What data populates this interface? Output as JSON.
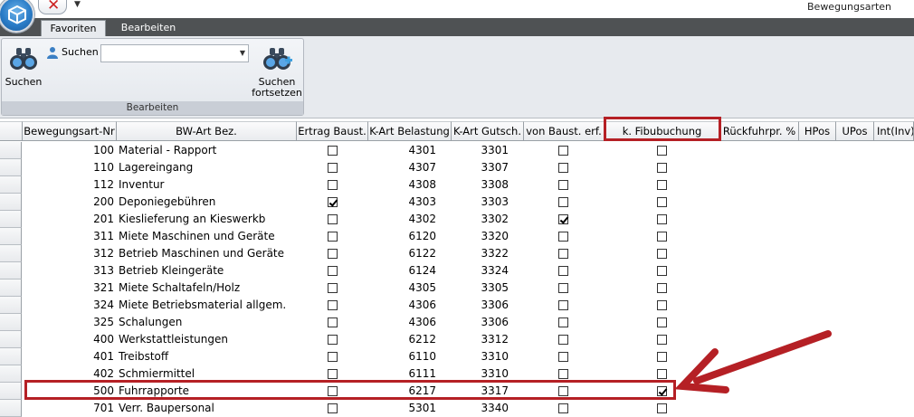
{
  "window": {
    "title": "Bewegungsarten"
  },
  "ribbon": {
    "tabs": [
      "Favoriten",
      "Bearbeiten"
    ],
    "group_label": "Bearbeiten",
    "search_label": "Suchen",
    "search_value": "",
    "btn_suchen": "Suchen",
    "btn_fortsetzen_1": "Suchen",
    "btn_fortsetzen_2": "fortsetzen"
  },
  "grid": {
    "columns": [
      "Bewegungsart-Nr",
      "BW-Art Bez.",
      "Ertrag Baust.",
      "K-Art Belastung",
      "K-Art Gutsch.",
      "von Baust. erf.",
      "k. Fibubuchung",
      "Rückfuhrpr. %",
      "HPos",
      "UPos",
      "Int(Inv)"
    ],
    "rows": [
      {
        "nr": "100",
        "bez": "Material - Rapport",
        "ertrag": false,
        "belast": "4301",
        "gutsch": "3301",
        "vonbaust": false,
        "fibu": false
      },
      {
        "nr": "110",
        "bez": "Lagereingang",
        "ertrag": false,
        "belast": "4307",
        "gutsch": "3307",
        "vonbaust": false,
        "fibu": false
      },
      {
        "nr": "112",
        "bez": "Inventur",
        "ertrag": false,
        "belast": "4308",
        "gutsch": "3308",
        "vonbaust": false,
        "fibu": false
      },
      {
        "nr": "200",
        "bez": "Deponiegebühren",
        "ertrag": true,
        "belast": "4303",
        "gutsch": "3303",
        "vonbaust": false,
        "fibu": false
      },
      {
        "nr": "201",
        "bez": "Kieslieferung an Kieswerkb",
        "ertrag": false,
        "belast": "4302",
        "gutsch": "3302",
        "vonbaust": true,
        "fibu": false
      },
      {
        "nr": "311",
        "bez": "Miete Maschinen und Geräte",
        "ertrag": false,
        "belast": "6120",
        "gutsch": "3320",
        "vonbaust": false,
        "fibu": false
      },
      {
        "nr": "312",
        "bez": "Betrieb Maschinen und Geräte",
        "ertrag": false,
        "belast": "6122",
        "gutsch": "3322",
        "vonbaust": false,
        "fibu": false
      },
      {
        "nr": "313",
        "bez": "Betrieb Kleingeräte",
        "ertrag": false,
        "belast": "6124",
        "gutsch": "3324",
        "vonbaust": false,
        "fibu": false
      },
      {
        "nr": "321",
        "bez": "Miete Schaltafeln/Holz",
        "ertrag": false,
        "belast": "4305",
        "gutsch": "3305",
        "vonbaust": false,
        "fibu": false
      },
      {
        "nr": "324",
        "bez": "Miete Betriebsmaterial allgem.",
        "ertrag": false,
        "belast": "4306",
        "gutsch": "3306",
        "vonbaust": false,
        "fibu": false
      },
      {
        "nr": "325",
        "bez": "Schalungen",
        "ertrag": false,
        "belast": "4306",
        "gutsch": "3306",
        "vonbaust": false,
        "fibu": false
      },
      {
        "nr": "400",
        "bez": "Werkstattleistungen",
        "ertrag": false,
        "belast": "6212",
        "gutsch": "3312",
        "vonbaust": false,
        "fibu": false
      },
      {
        "nr": "401",
        "bez": "Treibstoff",
        "ertrag": false,
        "belast": "6110",
        "gutsch": "3310",
        "vonbaust": false,
        "fibu": false
      },
      {
        "nr": "402",
        "bez": "Schmiermittel",
        "ertrag": false,
        "belast": "6111",
        "gutsch": "3310",
        "vonbaust": false,
        "fibu": false
      },
      {
        "nr": "500",
        "bez": "Fuhrrapporte",
        "ertrag": false,
        "belast": "6217",
        "gutsch": "3317",
        "vonbaust": false,
        "fibu": true
      },
      {
        "nr": "701",
        "bez": "Verr. Baupersonal",
        "ertrag": false,
        "belast": "5301",
        "gutsch": "3340",
        "vonbaust": false,
        "fibu": false
      }
    ]
  },
  "annotations": {
    "color": "#b52025",
    "highlight_column": "k. Fibubuchung",
    "highlight_row": "500"
  }
}
